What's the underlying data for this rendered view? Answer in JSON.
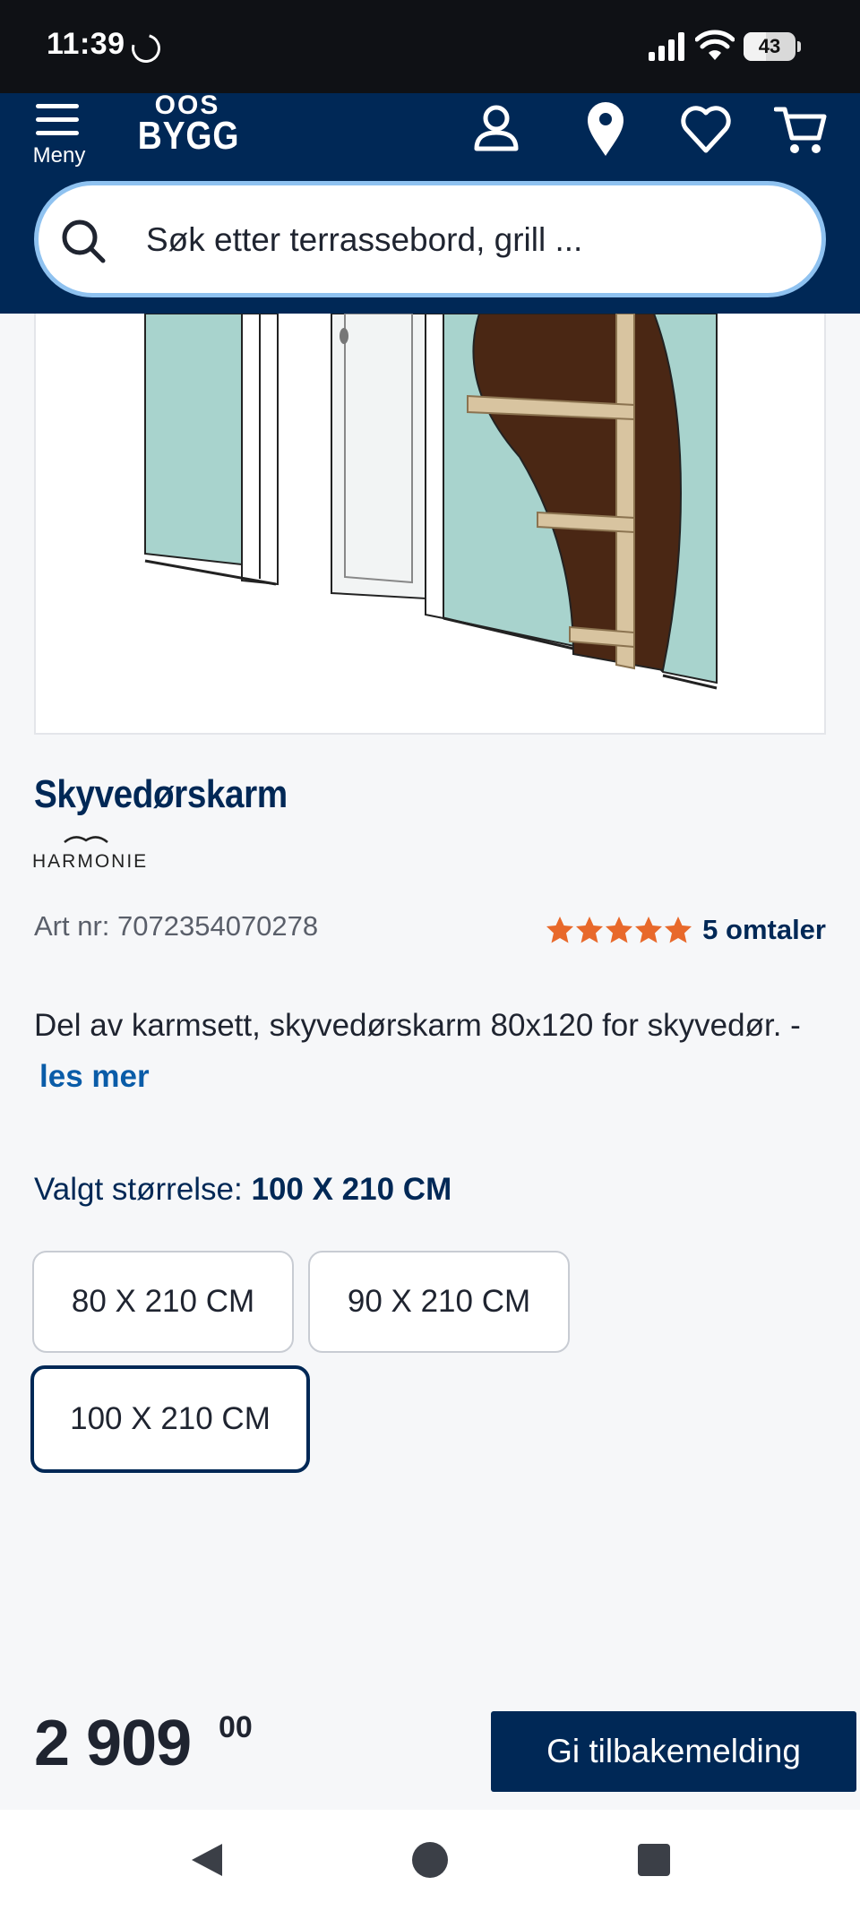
{
  "status_bar": {
    "time": "11:39",
    "battery_level": "43"
  },
  "header": {
    "menu_label": "Meny",
    "logo_top": "OOS",
    "logo_bottom": "BYGG",
    "search_placeholder": "Søk etter terrassebord, grill ..."
  },
  "product": {
    "title": "Skyvedørskarm",
    "brand": "HARMONIE",
    "art_nr": "Art nr: 7072354070278",
    "rating": 5,
    "reviews_label": "5 omtaler",
    "description": "Del av karmsett, skyvedørskarm 80x120 for skyvedør. -",
    "read_more": "les mer",
    "size_label": "Valgt størrelse:",
    "selected_size": "100 X 210 CM",
    "sizes": [
      "80 X 210 CM",
      "90 X 210 CM",
      "100 X 210 CM"
    ],
    "price_main": "2 909",
    "price_cents": "00"
  },
  "feedback_button": "Gi tilbakemelding",
  "colors": {
    "brand_navy": "#002856",
    "star_orange": "#e8692b",
    "link_blue": "#0a5ca8"
  }
}
